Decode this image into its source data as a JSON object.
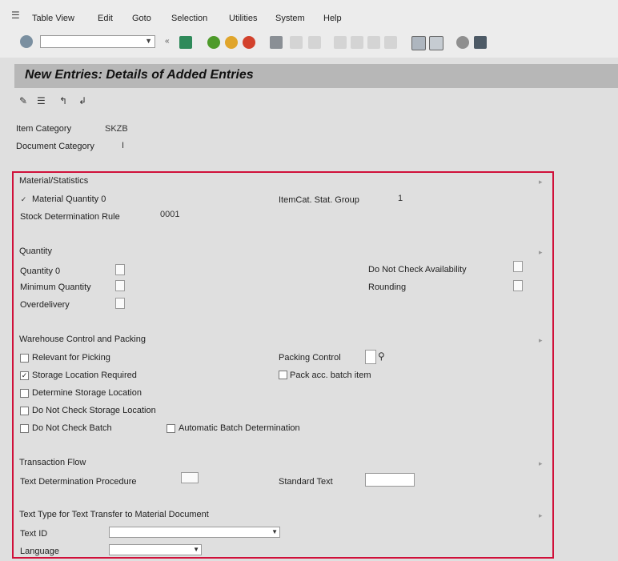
{
  "menubar": {
    "items": [
      "Table View",
      "Edit",
      "Goto",
      "Selection",
      "Utilities",
      "System",
      "Help"
    ]
  },
  "toolbar": {
    "command_field_value": ""
  },
  "title": "New Entries: Details of Added Entries",
  "header": {
    "item_category_label": "Item Category",
    "item_category_value": "SKZB",
    "document_category_label": "Document Category",
    "document_category_value": "I"
  },
  "sections": {
    "material_statistics": {
      "title": "Material/Statistics",
      "material_quantity_label": "Material Quantity 0",
      "item_cat_stat_group_label": "ItemCat. Stat. Group",
      "item_cat_stat_group_value": "1",
      "stock_det_rule_label": "Stock Determination Rule",
      "stock_det_rule_value": "0001"
    },
    "quantity": {
      "title": "Quantity",
      "quantity_label": "Quantity 0",
      "min_quantity_label": "Minimum Quantity",
      "overdelivery_label": "Overdelivery",
      "do_not_check_avail_label": "Do Not Check Availability",
      "rounding_label": "Rounding"
    },
    "warehouse": {
      "title": "Warehouse Control and Packing",
      "relevant_picking_label": "Relevant for Picking",
      "storage_loc_required_label": "Storage Location Required",
      "determine_storage_label": "Determine Storage Location",
      "no_check_storage_label": "Do Not Check Storage Location",
      "no_check_batch_label": "Do Not Check Batch",
      "auto_batch_label": "Automatic Batch Determination",
      "packing_control_label": "Packing Control",
      "pack_acc_batch_label": "Pack acc. batch item"
    },
    "transaction_flow": {
      "title": "Transaction Flow",
      "text_det_procedure_label": "Text Determination Procedure",
      "standard_text_label": "Standard Text"
    },
    "text_type": {
      "title": "Text Type for Text Transfer to Material Document",
      "text_id_label": "Text ID",
      "language_label": "Language"
    }
  },
  "colors": {
    "highlight_border": "#d0103a",
    "title_bar": "#b7b7b7",
    "background": "#dfdfdf"
  }
}
